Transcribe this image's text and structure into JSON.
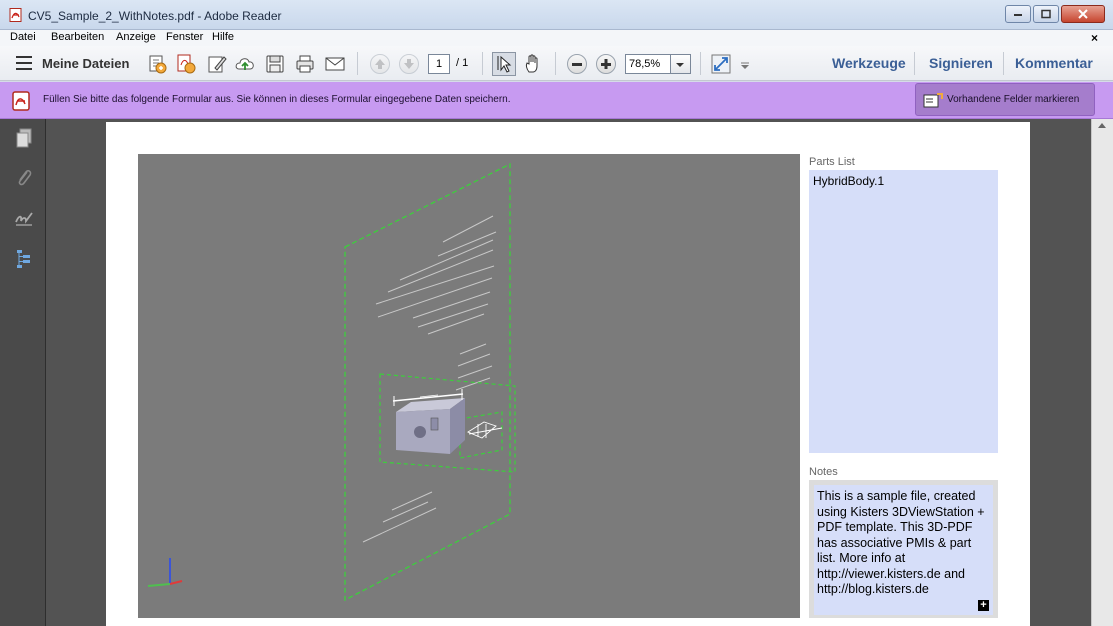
{
  "window": {
    "title": "CV5_Sample_2_WithNotes.pdf - Adobe Reader"
  },
  "menu": {
    "items": [
      "Datei",
      "Bearbeiten",
      "Anzeige",
      "Fenster",
      "Hilfe"
    ],
    "close_glyph": "×"
  },
  "toolbar": {
    "my_files_label": "Meine Dateien",
    "page_current": "1",
    "page_total": "/ 1",
    "zoom_value": "78,5%",
    "tools_link": "Werkzeuge",
    "sign_link": "Signieren",
    "comment_link": "Kommentar",
    "link_color": "#3b5f96"
  },
  "form_bar": {
    "message": "Füllen Sie bitte das folgende Formular aus. Sie können in dieses Formular eingegebene Daten speichern.",
    "highlight_button": "Vorhandene Felder markieren",
    "color": "#c79af1"
  },
  "document": {
    "parts_list_label": "Parts List",
    "parts": [
      "HybridBody.1"
    ],
    "notes_label": "Notes",
    "notes_text": "This is a sample file, created using Kisters 3DViewStation + PDF template. This 3D-PDF has associative PMIs & part list. More info at http://viewer.kisters.de and http://blog.kisters.de",
    "notes_expand_glyph": "+",
    "viewer_bg": "#7b7b7b",
    "panel_bg": "#d6def9"
  }
}
